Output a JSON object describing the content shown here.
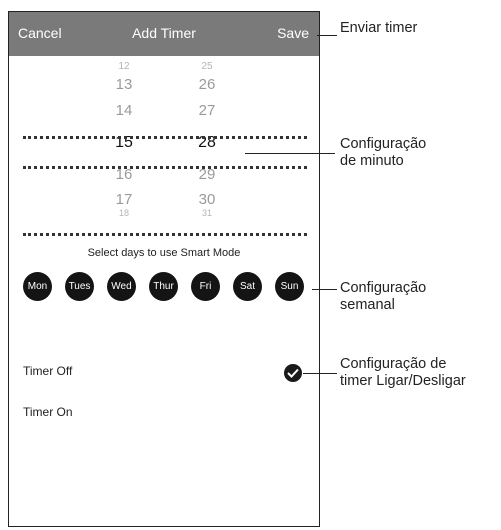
{
  "header": {
    "cancel_label": "Cancel",
    "title": "Add Timer",
    "save_label": "Save"
  },
  "picker": {
    "hours": [
      "12",
      "13",
      "14",
      "15",
      "16",
      "17",
      "18"
    ],
    "minutes": [
      "25",
      "26",
      "27",
      "28",
      "29",
      "30",
      "31"
    ],
    "selected_hour": "15",
    "selected_minute": "28"
  },
  "days_caption": "Select days to use Smart Mode",
  "days": [
    "Mon",
    "Tues",
    "Wed",
    "Thur",
    "Fri",
    "Sat",
    "Sun"
  ],
  "timer_options": {
    "off_label": "Timer Off",
    "on_label": "Timer On",
    "selected": "Timer Off"
  },
  "annotations": {
    "save": "Enviar timer",
    "minute_line1": "Configuração",
    "minute_line2": "de minuto",
    "week_line1": "Configuração",
    "week_line2": "semanal",
    "onoff_line1": "Configuração de",
    "onoff_line2": "timer Ligar/Desligar"
  },
  "colors": {
    "topbar": "#7a7a7a",
    "day_bubble": "#141414",
    "check": "#1a1a1a"
  }
}
